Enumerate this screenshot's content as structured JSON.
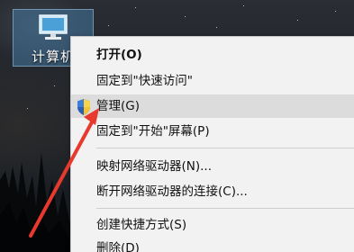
{
  "desktop": {
    "icon_label": "计算机"
  },
  "context_menu": {
    "items": [
      {
        "label": "打开(O)"
      },
      {
        "label": "固定到\"快速访问\""
      },
      {
        "label": "管理(G)"
      },
      {
        "label": "固定到\"开始\"屏幕(P)"
      },
      {
        "label": "映射网络驱动器(N)..."
      },
      {
        "label": "断开网络驱动器的连接(C)..."
      },
      {
        "label": "创建快捷方式(S)"
      },
      {
        "label": "删除(D)"
      }
    ]
  },
  "icons": {
    "desktop_icon": "computer-icon",
    "manage_icon": "uac-shield-icon",
    "annotation": "red-arrow"
  },
  "colors": {
    "menu_bg": "#f2f2f2",
    "highlight": "#dcdcdc",
    "selection": "#4f7fa6",
    "arrow": "#e8392e"
  }
}
